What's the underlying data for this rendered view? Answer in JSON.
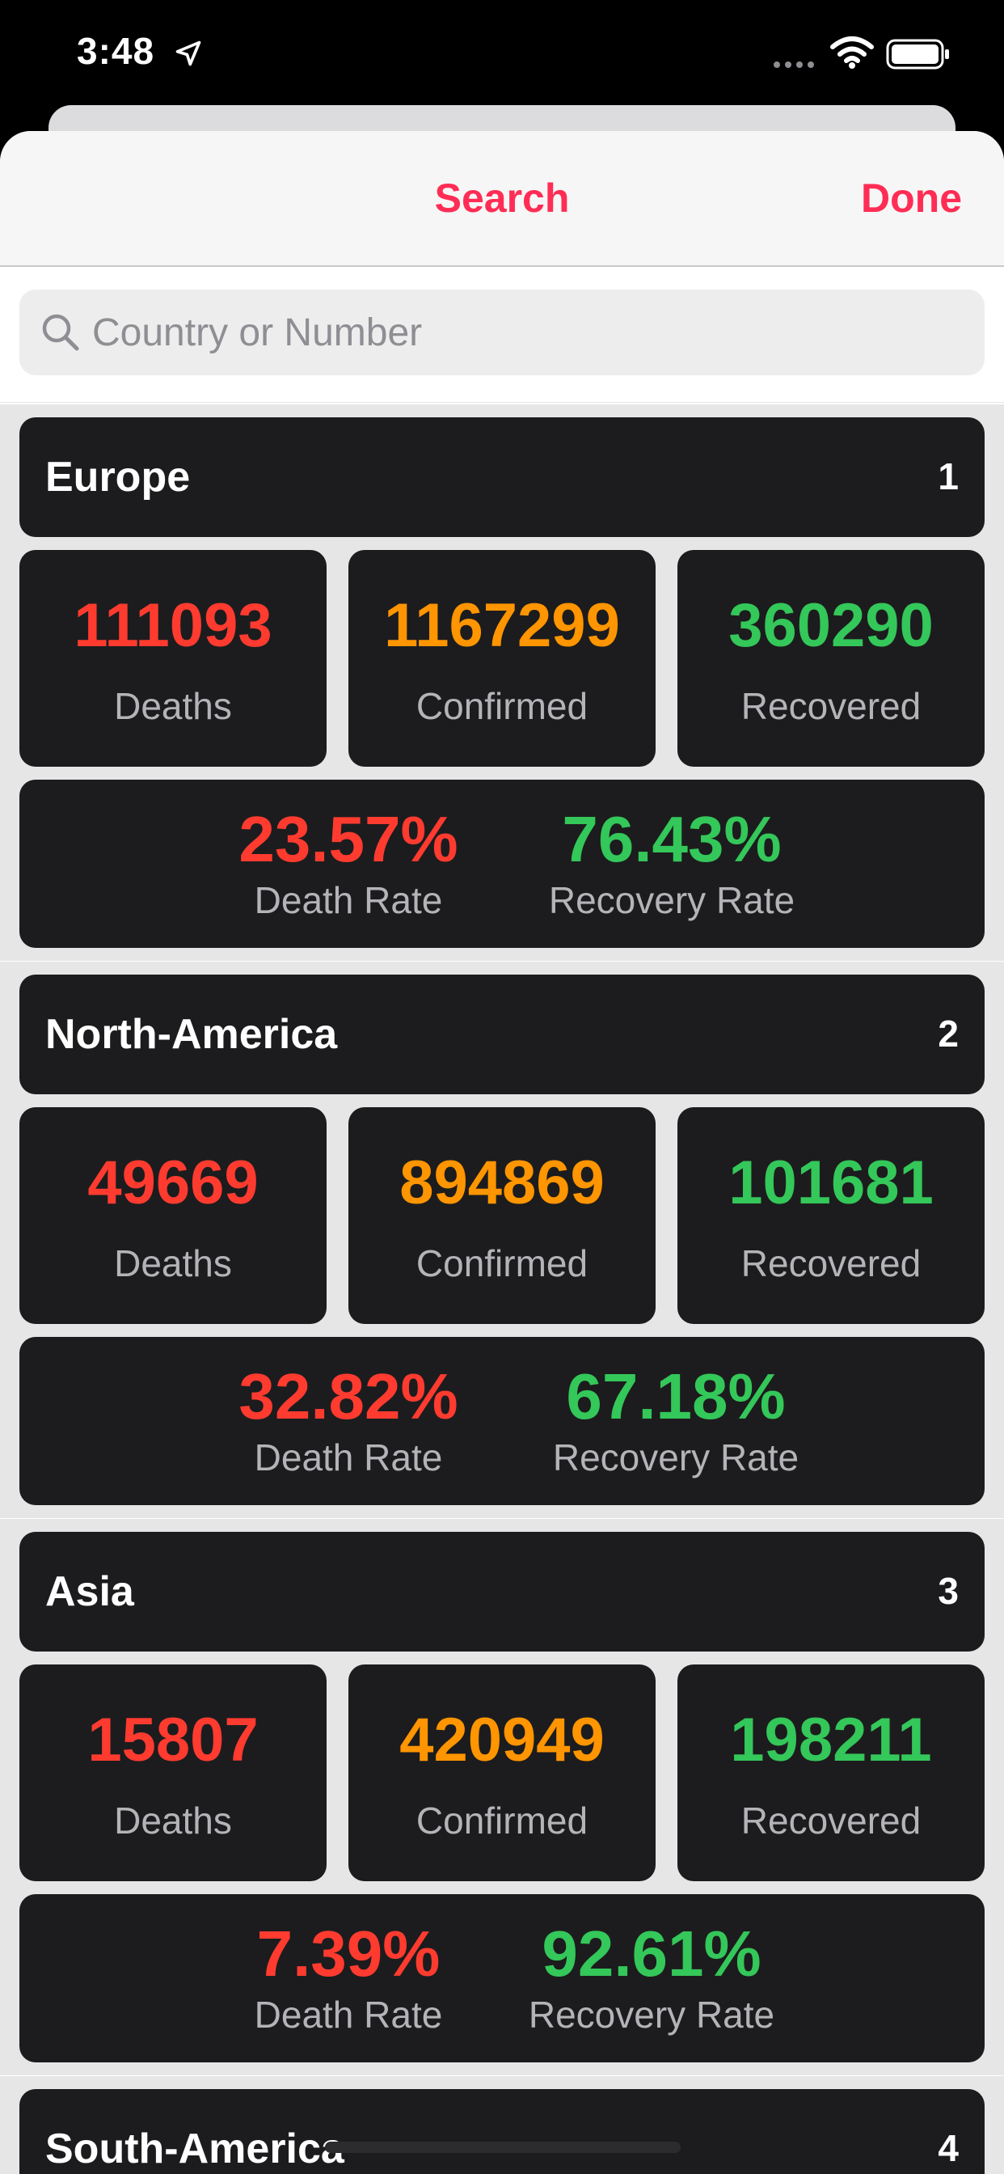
{
  "status_bar": {
    "time": "3:48"
  },
  "navbar": {
    "title": "Search",
    "done_label": "Done"
  },
  "search": {
    "placeholder": "Country or Number",
    "value": ""
  },
  "labels": {
    "deaths": "Deaths",
    "confirmed": "Confirmed",
    "recovered": "Recovered",
    "death_rate": "Death Rate",
    "recovery_rate": "Recovery Rate"
  },
  "regions": [
    {
      "name": "Europe",
      "rank": "1",
      "deaths": "111093",
      "confirmed": "1167299",
      "recovered": "360290",
      "death_rate": "23.57%",
      "recovery_rate": "76.43%"
    },
    {
      "name": "North-America",
      "rank": "2",
      "deaths": "49669",
      "confirmed": "894869",
      "recovered": "101681",
      "death_rate": "32.82%",
      "recovery_rate": "67.18%"
    },
    {
      "name": "Asia",
      "rank": "3",
      "deaths": "15807",
      "confirmed": "420949",
      "recovered": "198211",
      "death_rate": "7.39%",
      "recovery_rate": "92.61%"
    },
    {
      "name": "South-America",
      "rank": "4"
    }
  ],
  "colors": {
    "accent": "#ff2d55",
    "deaths": "#ff3b30",
    "confirmed": "#ff9500",
    "recovered": "#34c759",
    "card": "#1c1c1e"
  }
}
